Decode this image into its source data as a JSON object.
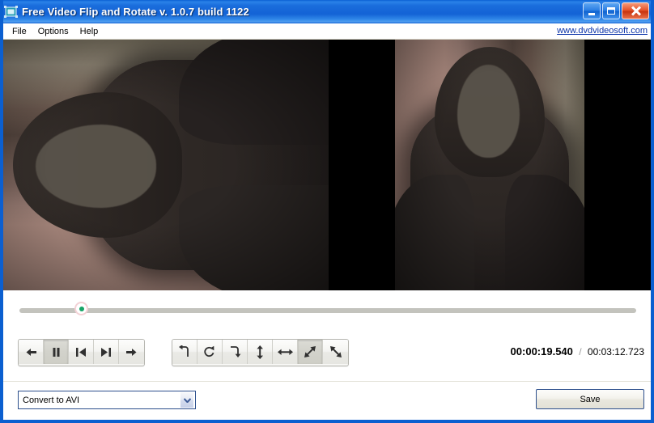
{
  "window": {
    "title": "Free Video Flip and Rotate v. 1.0.7 build 1122",
    "app_icon": "video-frame-icon",
    "buttons": {
      "minimize": "minimize-button",
      "maximize": "maximize-button",
      "close": "close-button"
    },
    "title_bar_color": "#1666d8"
  },
  "menu": {
    "items": [
      {
        "label": "File"
      },
      {
        "label": "Options"
      },
      {
        "label": "Help"
      }
    ],
    "site_link": "www.dvdvideosoft.com",
    "link_color": "#0b33a8"
  },
  "preview": {
    "background_color": "#000000",
    "left_pane_name": "rotated-preview",
    "right_pane_name": "source-preview"
  },
  "seek": {
    "position_percent": 10.2,
    "track_color": "#c3c3bd",
    "thumb_color": "#18a466"
  },
  "playback": {
    "buttons": [
      {
        "name": "step-back-button",
        "icon": "arrow-left-icon",
        "active": false
      },
      {
        "name": "pause-button",
        "icon": "pause-icon",
        "active": true
      },
      {
        "name": "previous-frame-button",
        "icon": "skip-previous-icon",
        "active": false
      },
      {
        "name": "next-frame-button",
        "icon": "skip-next-icon",
        "active": false
      },
      {
        "name": "step-forward-button",
        "icon": "arrow-right-icon",
        "active": false
      }
    ]
  },
  "transform": {
    "buttons": [
      {
        "name": "rotate-left-90-button",
        "icon": "rotate-left-icon",
        "active": false
      },
      {
        "name": "rotate-180-button",
        "icon": "rotate-loop-icon",
        "active": false
      },
      {
        "name": "rotate-right-90-button",
        "icon": "rotate-right-icon",
        "active": false
      },
      {
        "name": "flip-vertical-button",
        "icon": "arrow-up-down-icon",
        "active": false
      },
      {
        "name": "flip-horizontal-button",
        "icon": "arrow-left-right-icon",
        "active": false
      },
      {
        "name": "flip-diagonal-up-button",
        "icon": "arrow-diagonal-up-icon",
        "active": true
      },
      {
        "name": "flip-diagonal-down-button",
        "icon": "arrow-diagonal-down-icon",
        "active": false
      }
    ]
  },
  "time": {
    "current": "00:00:19.540",
    "separator": "/",
    "total": "00:03:12.723"
  },
  "output": {
    "format_label": "Convert to AVI",
    "save_label": "Save"
  }
}
